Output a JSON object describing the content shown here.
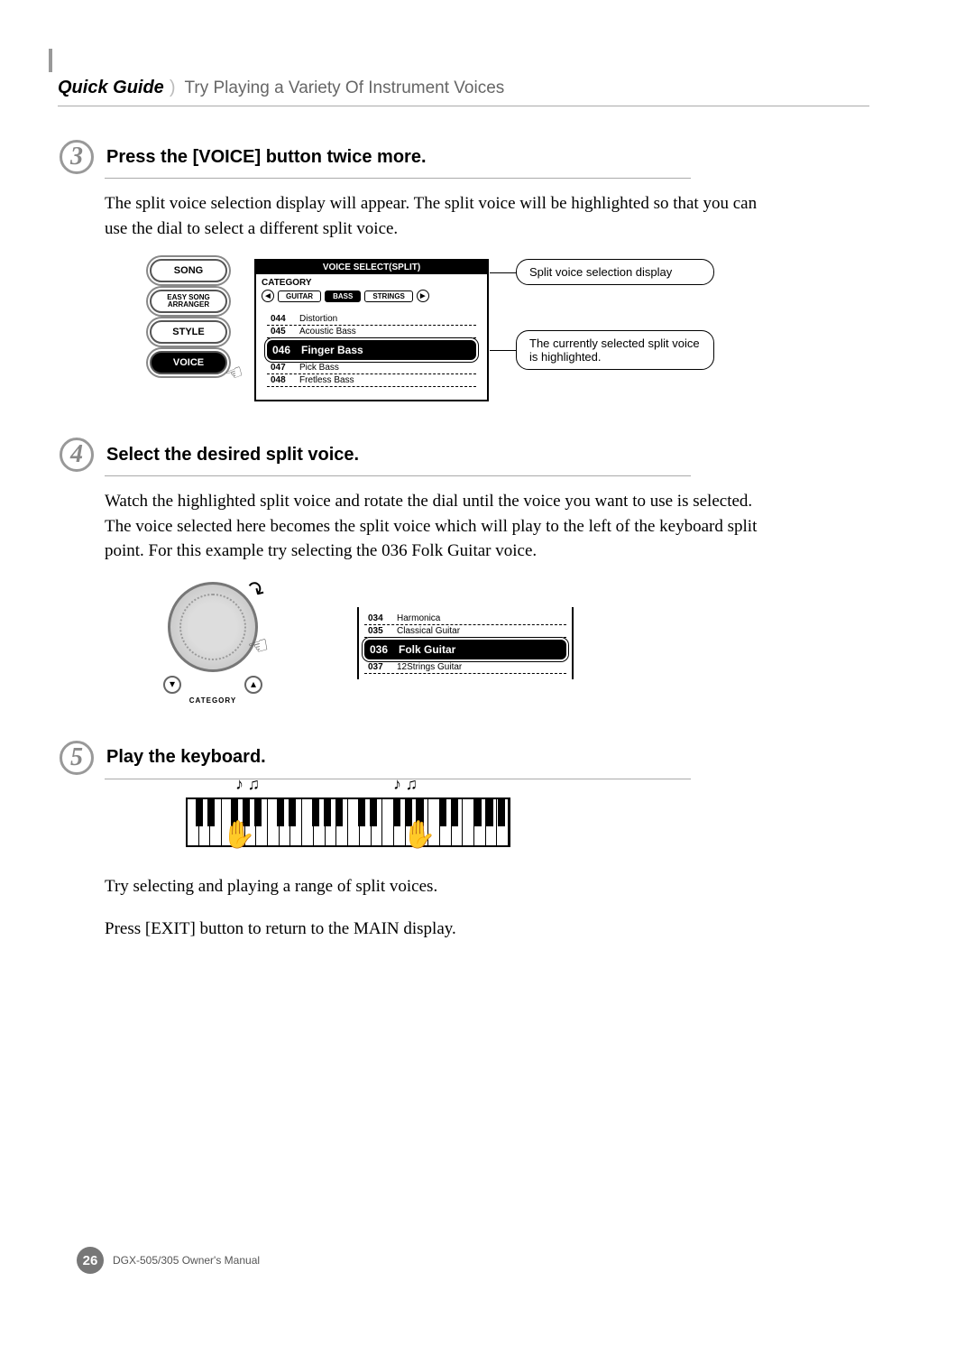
{
  "header": {
    "quick_guide": "Quick Guide",
    "subtitle": "Try Playing a Variety Of Instrument Voices"
  },
  "step3": {
    "number": "3",
    "title": "Press the [VOICE] button twice more.",
    "body": "The split voice selection display will appear. The split voice will be highlighted so that you can use the dial to select a different split voice.",
    "buttons": {
      "song": "SONG",
      "easy": "EASY SONG\nARRANGER",
      "style": "STYLE",
      "voice": "VOICE"
    },
    "lcd": {
      "title": "VOICE SELECT(SPLIT)",
      "category_label": "CATEGORY",
      "tab_left": "GUITAR",
      "tab_active": "BASS",
      "tab_right": "STRINGS",
      "items": [
        {
          "num": "044",
          "name": "Distortion"
        },
        {
          "num": "045",
          "name": "Acoustic Bass"
        },
        {
          "num": "046",
          "name": "Finger Bass",
          "selected": true
        },
        {
          "num": "047",
          "name": "Pick Bass"
        },
        {
          "num": "048",
          "name": "Fretless Bass"
        }
      ]
    },
    "callout1": "Split voice selection display",
    "callout2": "The currently selected split voice is highlighted."
  },
  "step4": {
    "number": "4",
    "title": "Select the desired split voice.",
    "body": "Watch the highlighted split voice and rotate the dial until the voice you want to use is selected. The voice selected here becomes the split voice which will play to the left of the keyboard split point. For this example try selecting the 036 Folk Guitar voice.",
    "dial_label": "CATEGORY",
    "lcd_items": [
      {
        "num": "034",
        "name": "Harmonica"
      },
      {
        "num": "035",
        "name": "Classical Guitar"
      },
      {
        "num": "036",
        "name": "Folk Guitar",
        "selected": true
      },
      {
        "num": "037",
        "name": "12Strings Guitar"
      }
    ]
  },
  "step5": {
    "number": "5",
    "title": "Play the keyboard.",
    "line1": "Try selecting and playing a range of split voices.",
    "line2": "Press [EXIT] button to return to the MAIN display."
  },
  "footer": {
    "page": "26",
    "text": "DGX-505/305  Owner's Manual"
  }
}
